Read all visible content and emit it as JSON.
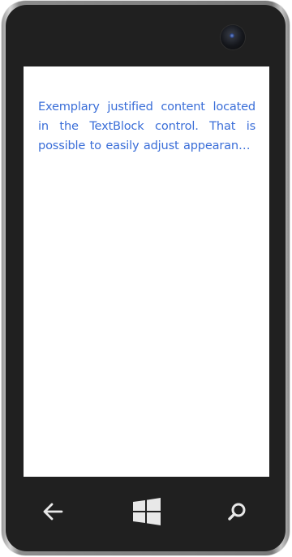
{
  "screen": {
    "text_block": {
      "content": "Exemplary justified content located in the TextBlock control. That is possible to easily adjust appearance, including alignment and font.",
      "color": "#3a6ed8"
    }
  },
  "hardware_buttons": {
    "back": {
      "icon": "back-arrow-icon"
    },
    "start": {
      "icon": "windows-logo-icon"
    },
    "search": {
      "icon": "search-icon"
    }
  },
  "device": {
    "camera_icon": "front-camera-icon",
    "bezel_color": "#202020",
    "screen_background": "#ffffff"
  }
}
